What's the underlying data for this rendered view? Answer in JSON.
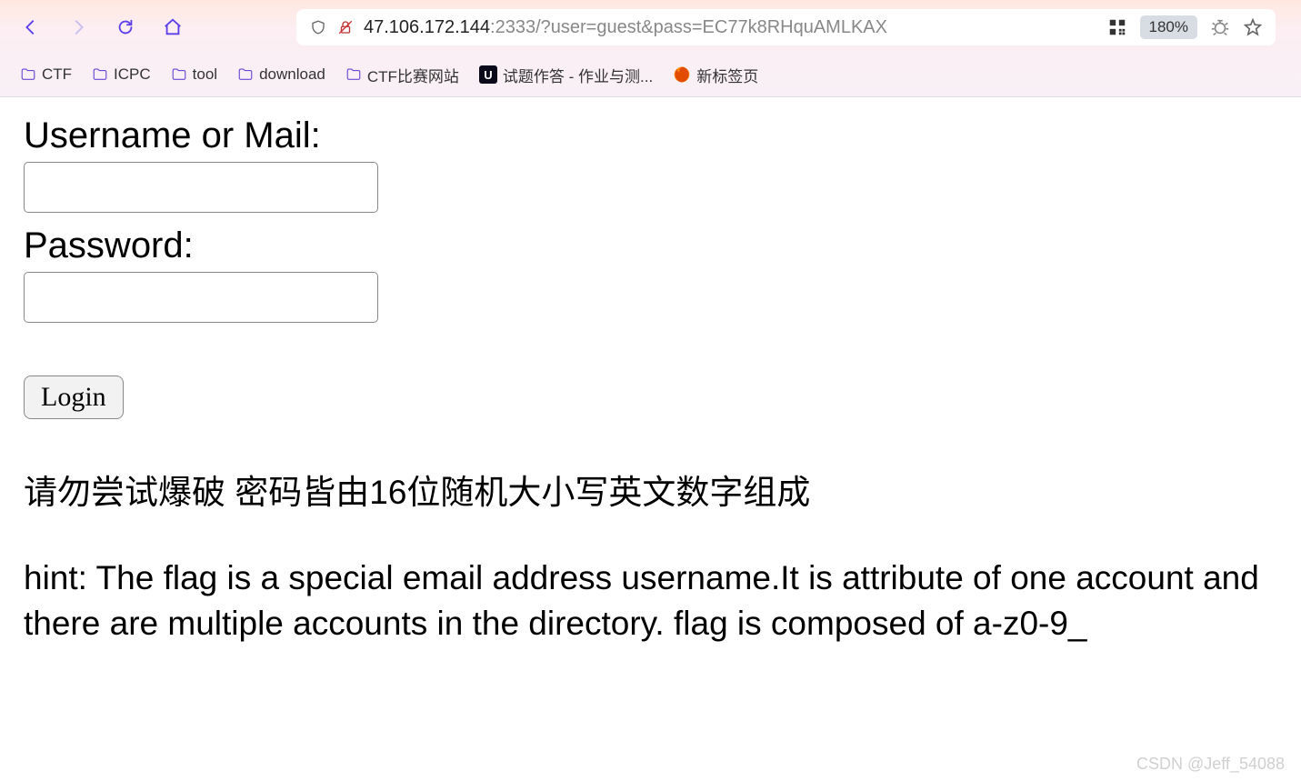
{
  "browser": {
    "url_host": "47.106.172.144",
    "url_rest": ":2333/?user=guest&pass=EC77k8RHquAMLKAX",
    "zoom": "180%"
  },
  "bookmarks": [
    {
      "type": "folder",
      "label": "CTF"
    },
    {
      "type": "folder",
      "label": "ICPC"
    },
    {
      "type": "folder",
      "label": "tool"
    },
    {
      "type": "folder",
      "label": "download"
    },
    {
      "type": "folder",
      "label": "CTF比赛网站"
    },
    {
      "type": "u",
      "label": "试题作答 - 作业与测..."
    },
    {
      "type": "ff",
      "label": "新标签页"
    }
  ],
  "form": {
    "username_label": "Username or Mail:",
    "username_value": "",
    "password_label": "Password:",
    "password_value": "",
    "login_button": "Login"
  },
  "messages": {
    "warning": "请勿尝试爆破 密码皆由16位随机大小写英文数字组成",
    "hint": "hint: The flag is a special email address username.It is attribute of one account and there are multiple accounts in the directory. flag is composed of a-z0-9_"
  },
  "watermark": "CSDN @Jeff_54088"
}
